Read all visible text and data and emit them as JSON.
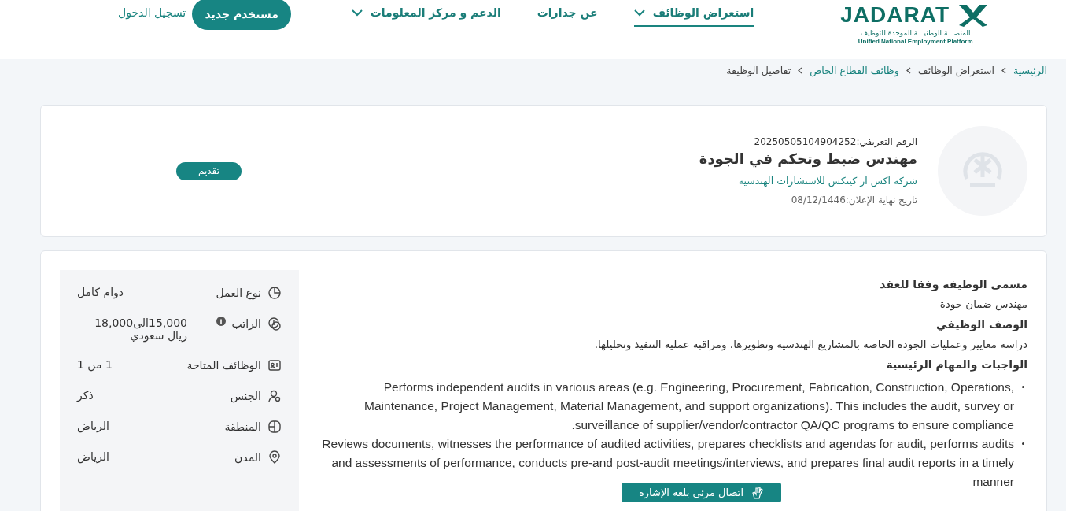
{
  "header": {
    "logo": {
      "wordmark": "JADARAT",
      "subtitle_ar": "المنصـــة الوطنيـــة الموحدة للتوظيف",
      "subtitle_en": "Unified National Employment Platform"
    },
    "nav": [
      {
        "label": "استعراض الوظائف",
        "dropdown": true,
        "selected": true
      },
      {
        "label": "عن جدارات",
        "dropdown": false,
        "selected": false
      },
      {
        "label": "الدعم و مركز المعلومات",
        "dropdown": true,
        "selected": false
      }
    ],
    "register_button": "مستخدم جديد",
    "login_link": "تسجيل الدخول"
  },
  "breadcrumbs": [
    {
      "label": "الرئيسية",
      "link": true
    },
    {
      "label": "استعراض الوظائف",
      "link": false
    },
    {
      "label": "وظائف القطاع الخاص",
      "link": true
    },
    {
      "label": "تفاصيل الوظيفة",
      "link": false
    }
  ],
  "job": {
    "reference": "الرقم التعريفي:20250505104904252",
    "title": "مهندس ضبط وتحكم في الجودة",
    "company": "شركة اكس ار كيتكس للاستشارات الهندسية",
    "deadline": "تاريخ نهاية الإعلان:08/12/1446",
    "apply_button": "تقديم"
  },
  "details": [
    {
      "label": "نوع العمل",
      "value": "دوام كامل",
      "info": false
    },
    {
      "label": "الراتب",
      "value": "15,000الى18,000 ريال سعودي",
      "info": true
    },
    {
      "label": "الوظائف المتاحة",
      "value": "1 من 1",
      "info": false
    },
    {
      "label": "الجنس",
      "value": "ذكر",
      "info": false
    },
    {
      "label": "المنطقة",
      "value": "الرياض",
      "info": false
    },
    {
      "label": "المدن",
      "value": "الرياض",
      "info": false
    }
  ],
  "sections": [
    {
      "heading": "مسمى الوظيفة وفقا للعقد",
      "text": "مهندس ضمان جودة"
    },
    {
      "heading": "الوصف الوظيفي",
      "text": "دراسة معايير وعمليات الجودة الخاصة بالمشاريع الهندسية وتطويرها، ومراقبة عملية التنفيذ وتحليلها."
    },
    {
      "heading": "الواجبات والمهام الرئيسية",
      "bullets": [
        "Performs independent audits in various areas (e.g. Engineering, Procurement, Fabrication, Construction, Operations, Maintenance, Project Management, Material Management, and support organizations). This includes the audit, survey or surveillance of supplier/vendor/contractor QA/QC programs to ensure compliance.",
        "Reviews documents, witnesses the performance of audited activities, prepares checklists and agendas for audit, performs audits and assessments of performance, conducts pre-and post-audit meetings/interviews, and prepares final audit reports in a timely manner"
      ]
    }
  ],
  "sign_language_button": "اتصال مرئي بلغة الإشارة"
}
